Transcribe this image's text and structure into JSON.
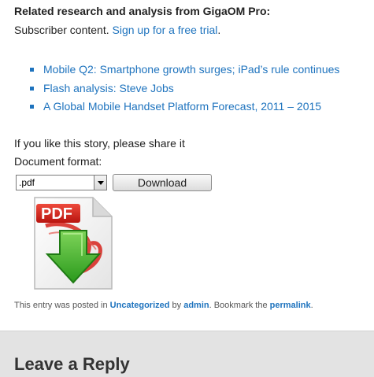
{
  "related": {
    "heading": "Related research and analysis from GigaOM Pro:",
    "subscriber_text": "Subscriber content. ",
    "signup_link": "Sign up for a free trial",
    "signup_suffix": ".",
    "items": [
      {
        "label": "Mobile Q2: Smartphone growth surges; iPad’s rule continues"
      },
      {
        "label": "Flash analysis: Steve Jobs"
      },
      {
        "label": "A Global Mobile Handset Platform Forecast, 2011 – 2015"
      }
    ]
  },
  "share": {
    "text": "If you like this story, please share it",
    "format_label": "Document format:",
    "format_selected": ".pdf",
    "download_label": "Download",
    "icon_text": "PDF"
  },
  "postmeta": {
    "prefix": "This entry was posted in ",
    "category": "Uncategorized",
    "by": " by ",
    "author": "admin",
    "bookmark": ". Bookmark the ",
    "permalink": "permalink",
    "suffix": "."
  },
  "reply": {
    "title": "Leave a Reply"
  },
  "colors": {
    "link": "#1e73be",
    "reply_band": "#e3e3e3",
    "pdf_red": "#d6231c",
    "arrow_green": "#3fae2a"
  }
}
